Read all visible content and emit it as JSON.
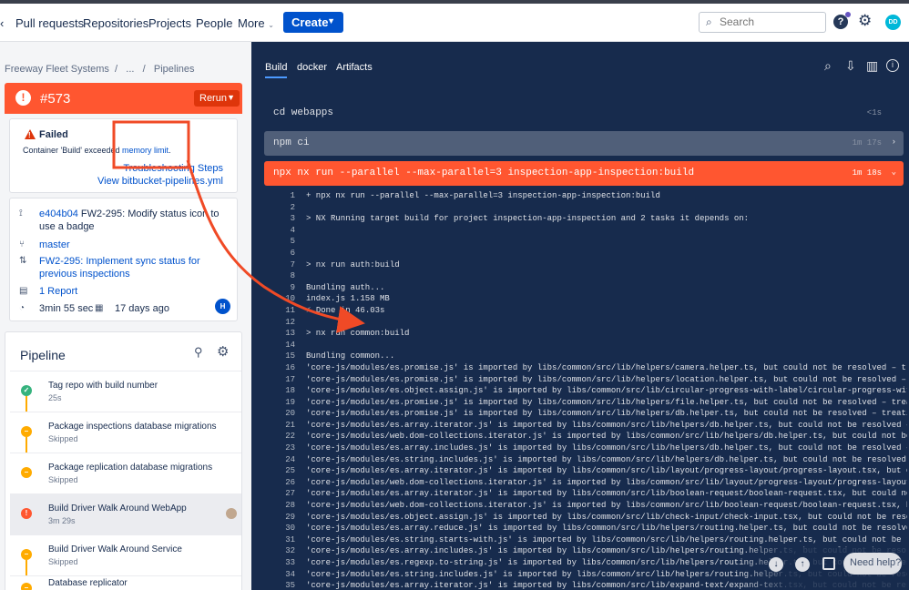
{
  "nav": {
    "items": [
      "Pull requests",
      "Repositories",
      "Projects",
      "People",
      "More"
    ],
    "create": "Create",
    "search_placeholder": "Search",
    "avatar_initials": "DD"
  },
  "breadcrumb": [
    "Freeway Fleet Systems",
    "...",
    "Pipelines"
  ],
  "build": {
    "number": "#573",
    "rerun": "Rerun",
    "status": "Failed",
    "message_prefix": "Container 'Build' exceeded ",
    "message_link": "memory limit",
    "message_suffix": ".",
    "troubleshooting": "Troubleshooting Steps",
    "view_yml": "View bitbucket-pipelines.yml"
  },
  "commit": {
    "hash": "e404b04",
    "message": " FW2-295: Modify status icon to use a badge",
    "branch": "master",
    "pr": "FW2-295: Implement sync status for previous inspections",
    "report": "1 Report",
    "duration": "3min 55 sec",
    "age": "17 days ago",
    "author_initial": "H"
  },
  "pipeline": {
    "title": "Pipeline",
    "steps": [
      {
        "name": "Tag repo with build number",
        "sub": "25s",
        "status": "ok"
      },
      {
        "name": "Package inspections database migrations",
        "sub": "Skipped",
        "status": "skip"
      },
      {
        "name": "Package replication database migrations",
        "sub": "Skipped",
        "status": "skip"
      },
      {
        "name": "Build Driver Walk Around WebApp",
        "sub": "3m 29s",
        "status": "err"
      },
      {
        "name": "Build Driver Walk Around Service",
        "sub": "Skipped",
        "status": "skip"
      },
      {
        "name": "Database replicator",
        "sub": "",
        "status": "skip"
      }
    ]
  },
  "tabs": [
    "Build",
    "docker",
    "Artifacts"
  ],
  "commands": [
    {
      "text": "cd webapps",
      "duration": "<1s",
      "style": "plain"
    },
    {
      "text": "npm ci",
      "duration": "1m 17s",
      "style": "grey"
    },
    {
      "text": "npx nx run --parallel --max-parallel=3 inspection-app-inspection:build",
      "duration": "1m 18s",
      "style": "red"
    }
  ],
  "log": [
    "+ npx nx run --parallel --max-parallel=3 inspection-app-inspection:build",
    "",
    " >  NX   Running target build for project inspection-app-inspection and 2 tasks it depends on:",
    "",
    "",
    "",
    "> nx run auth:build",
    "",
    "Bundling auth...",
    "  index.js 1.158 MB",
    "⚡ Done in 46.03s",
    "",
    "> nx run common:build",
    "",
    "Bundling common...",
    "'core-js/modules/es.promise.js' is imported by libs/common/src/lib/helpers/camera.helper.ts, but could not be resolved – treating",
    "'core-js/modules/es.promise.js' is imported by libs/common/src/lib/helpers/location.helper.ts, but could not be resolved – treat",
    "'core-js/modules/es.object.assign.js' is imported by libs/common/src/lib/circular-progress-with-label/circular-progress-with-lab",
    "'core-js/modules/es.promise.js' is imported by libs/common/src/lib/helpers/file.helper.ts, but could not be resolved – treating",
    "'core-js/modules/es.promise.js' is imported by libs/common/src/lib/helpers/db.helper.ts, but could not be resolved – treating it",
    "'core-js/modules/es.array.iterator.js' is imported by libs/common/src/lib/helpers/db.helper.ts, but could not be resolved – trea",
    "'core-js/modules/web.dom-collections.iterator.js' is imported by libs/common/src/lib/helpers/db.helper.ts, but could not be reso",
    "'core-js/modules/es.array.includes.js' is imported by libs/common/src/lib/helpers/db.helper.ts, but could not be resolved – trea",
    "'core-js/modules/es.string.includes.js' is imported by libs/common/src/lib/helpers/db.helper.ts, but could not be resolved – tre",
    "'core-js/modules/es.array.iterator.js' is imported by libs/common/src/lib/layout/progress-layout/progress-layout.tsx, but could",
    "'core-js/modules/web.dom-collections.iterator.js' is imported by libs/common/src/lib/layout/progress-layout/progress-layout.tsx,",
    "'core-js/modules/es.array.iterator.js' is imported by libs/common/src/lib/boolean-request/boolean-request.tsx, but could not be",
    "'core-js/modules/web.dom-collections.iterator.js' is imported by libs/common/src/lib/boolean-request/boolean-request.tsx, but co",
    "'core-js/modules/es.object.assign.js' is imported by libs/common/src/lib/check-input/check-input.tsx, but could not be resolved",
    "'core-js/modules/es.array.reduce.js' is imported by libs/common/src/lib/helpers/routing.helper.ts, but could not be resolved – t",
    "'core-js/modules/es.string.starts-with.js' is imported by libs/common/src/lib/helpers/routing.helper.ts, but could not be resolv",
    "'core-js/modules/es.array.includes.js' is imported by libs/common/src/lib/helpers/routing.helper.ts, but could not be resolved –",
    "'core-js/modules/es.regexp.to-string.js' is imported by libs/common/src/lib/helpers/routing.helper.ts, but could not be resolv",
    "'core-js/modules/es.string.includes.js' is imported by libs/common/src/lib/helpers/routing.helper.ts, but could not be resolv",
    "'core-js/modules/es.array.iterator.js' is imported by libs/common/src/lib/expand-text/expand-text.tsx, but could not be resolv"
  ],
  "need_help": "Need help?",
  "annotation_color": "#f04a26"
}
